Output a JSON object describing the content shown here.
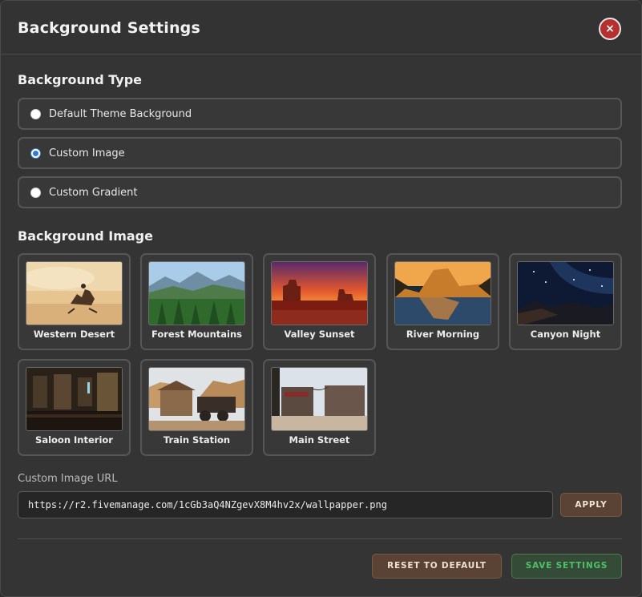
{
  "modal": {
    "title": "Background Settings",
    "close_label": "×"
  },
  "background_type": {
    "heading": "Background Type",
    "options": [
      {
        "label": "Default Theme Background",
        "checked": false
      },
      {
        "label": "Custom Image",
        "checked": true
      },
      {
        "label": "Custom Gradient",
        "checked": false
      }
    ]
  },
  "background_image": {
    "heading": "Background Image",
    "images": [
      {
        "label": "Western Desert"
      },
      {
        "label": "Forest Mountains"
      },
      {
        "label": "Valley Sunset"
      },
      {
        "label": "River Morning"
      },
      {
        "label": "Canyon Night"
      },
      {
        "label": "Saloon Interior"
      },
      {
        "label": "Train Station"
      },
      {
        "label": "Main Street"
      }
    ]
  },
  "custom_url": {
    "label": "Custom Image URL",
    "value": "https://r2.fivemanage.com/1cGb3aQ4NZgevX8M4hv2x/wallpapper.png",
    "apply_label": "APPLY"
  },
  "footer": {
    "reset_label": "RESET TO DEFAULT",
    "save_label": "SAVE SETTINGS"
  }
}
